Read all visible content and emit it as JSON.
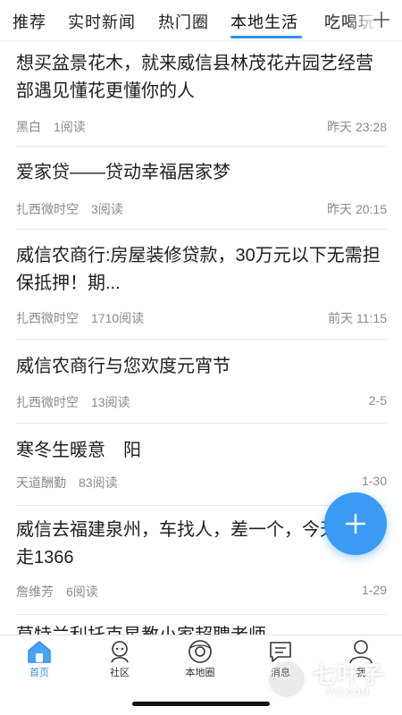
{
  "tabs": [
    {
      "label": "推荐"
    },
    {
      "label": "实时新闻"
    },
    {
      "label": "热门圈"
    },
    {
      "label": "本地生活",
      "active": true
    },
    {
      "label": "吃喝玩"
    }
  ],
  "accent_color": "#2f8ff0",
  "feed": [
    {
      "title": "想买盆景花木，就来威信县林茂花卉园艺经营部遇见懂花更懂你的人",
      "author": "黑白",
      "reads": "1阅读",
      "time": "昨天 23:28"
    },
    {
      "title": "爱家贷——贷动幸福居家梦",
      "author": "扎西微时空",
      "reads": "3阅读",
      "time": "昨天 20:15"
    },
    {
      "title": "威信农商行:房屋装修贷款，30万元以下无需担保抵押！期...",
      "author": "扎西微时空",
      "reads": "1710阅读",
      "time": "前天 11:15"
    },
    {
      "title": "威信农商行与您欢度元宵节",
      "author": "扎西微时空",
      "reads": "13阅读",
      "time": "2-5"
    },
    {
      "title": "寒冬生暖意　阳",
      "author": "天道酬勤",
      "reads": "83阅读",
      "time": "1-30"
    },
    {
      "title": "威信去福建泉州，车找人，差一个，今天下午走1366",
      "author": "詹维芳",
      "reads": "6阅读",
      "time": "1-29"
    },
    {
      "title": "莫特兰利托克星教小家超聘老师",
      "author": "",
      "reads": "",
      "time": ""
    }
  ],
  "bottom_nav": [
    {
      "label": "首页",
      "icon": "home-icon",
      "active": true
    },
    {
      "label": "社区",
      "icon": "community-icon"
    },
    {
      "label": "本地圈",
      "icon": "local-circle-icon"
    },
    {
      "label": "消息",
      "icon": "message-icon"
    },
    {
      "label": "我",
      "icon": "profile-icon"
    }
  ],
  "watermark": {
    "text": "七叶子",
    "sub": "7YZ.COM"
  }
}
